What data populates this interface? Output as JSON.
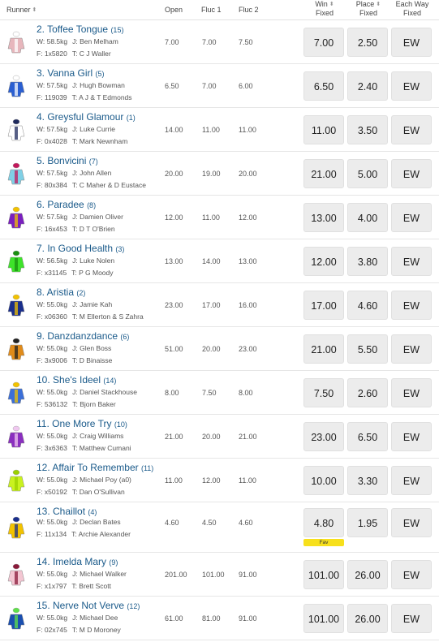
{
  "header": {
    "runner": "Runner",
    "open": "Open",
    "fluc1": "Fluc 1",
    "fluc2": "Fluc 2",
    "win_l1": "Win",
    "win_l2": "Fixed",
    "place_l1": "Place",
    "place_l2": "Fixed",
    "ew_l1": "Each Way",
    "ew_l2": "Fixed",
    "sort_icon": "⬍"
  },
  "runners": [
    {
      "name": "2. Toffee Tongue",
      "barrier": "(15)",
      "weight": "W: 58.5kg",
      "jockey": "J: Ben Melham",
      "form": "F: 1x5820",
      "trainer": "T: C J Waller",
      "open": "7.00",
      "fluc1": "7.00",
      "fluc2": "7.50",
      "win": "7.00",
      "place": "2.50",
      "ew": "EW",
      "fav": "",
      "silk_colors": [
        "#e7b6bc",
        "#ffffff"
      ],
      "silk_icon": "silk-striped-pink-icon"
    },
    {
      "name": "3. Vanna Girl",
      "barrier": "(5)",
      "weight": "W: 57.5kg",
      "jockey": "J: Hugh Bowman",
      "form": "F: 119039",
      "trainer": "T: A J & T Edmonds",
      "open": "6.50",
      "fluc1": "7.00",
      "fluc2": "6.00",
      "win": "6.50",
      "place": "2.40",
      "ew": "EW",
      "fav": "",
      "silk_colors": [
        "#2b5fd1",
        "#ffffff"
      ],
      "silk_icon": "silk-blue-white-icon"
    },
    {
      "name": "4. Greysful Glamour",
      "barrier": "(1)",
      "weight": "W: 57.5kg",
      "jockey": "J: Luke Currie",
      "form": "F: 0x4028",
      "trainer": "T: Mark Newnham",
      "open": "14.00",
      "fluc1": "11.00",
      "fluc2": "11.00",
      "win": "11.00",
      "place": "3.50",
      "ew": "EW",
      "fav": "",
      "silk_colors": [
        "#ffffff",
        "#1f2a5c"
      ],
      "silk_icon": "silk-white-navy-icon"
    },
    {
      "name": "5. Bonvicini",
      "barrier": "(7)",
      "weight": "W: 57.5kg",
      "jockey": "J: John Allen",
      "form": "F: 80x384",
      "trainer": "T: C Maher & D Eustace",
      "open": "20.00",
      "fluc1": "19.00",
      "fluc2": "20.00",
      "win": "21.00",
      "place": "5.00",
      "ew": "EW",
      "fav": "",
      "silk_colors": [
        "#7fd0e6",
        "#c2185b"
      ],
      "silk_icon": "silk-lightblue-cross-icon"
    },
    {
      "name": "6. Paradee",
      "barrier": "(8)",
      "weight": "W: 57.5kg",
      "jockey": "J: Damien Oliver",
      "form": "F: 16x453",
      "trainer": "T: D T O'Brien",
      "open": "12.00",
      "fluc1": "11.00",
      "fluc2": "12.00",
      "win": "13.00",
      "place": "4.00",
      "ew": "EW",
      "fav": "",
      "silk_colors": [
        "#7a1fbf",
        "#f2c200"
      ],
      "silk_icon": "silk-purple-yellow-icon"
    },
    {
      "name": "7. In Good Health",
      "barrier": "(3)",
      "weight": "W: 56.5kg",
      "jockey": "J: Luke Nolen",
      "form": "F: x31145",
      "trainer": "T: P G Moody",
      "open": "13.00",
      "fluc1": "14.00",
      "fluc2": "13.00",
      "win": "12.00",
      "place": "3.80",
      "ew": "EW",
      "fav": "",
      "silk_colors": [
        "#3ee32a",
        "#1a8f10"
      ],
      "silk_icon": "silk-green-icon"
    },
    {
      "name": "8. Aristia",
      "barrier": "(2)",
      "weight": "W: 55.0kg",
      "jockey": "J: Jamie Kah",
      "form": "F: x06360",
      "trainer": "T: M Ellerton & S Zahra",
      "open": "23.00",
      "fluc1": "17.00",
      "fluc2": "16.00",
      "win": "17.00",
      "place": "4.60",
      "ew": "EW",
      "fav": "",
      "silk_colors": [
        "#1a2f8c",
        "#f2c200"
      ],
      "silk_icon": "silk-navy-yellow-icon"
    },
    {
      "name": "9. Danzdanzdance",
      "barrier": "(6)",
      "weight": "W: 55.0kg",
      "jockey": "J: Glen Boss",
      "form": "F: 3x9006",
      "trainer": "T: D Binaisse",
      "open": "51.00",
      "fluc1": "20.00",
      "fluc2": "23.00",
      "win": "21.00",
      "place": "5.50",
      "ew": "EW",
      "fav": "",
      "silk_colors": [
        "#e08b1a",
        "#222222"
      ],
      "silk_icon": "silk-orange-cross-icon"
    },
    {
      "name": "10. She's Ideel",
      "barrier": "(14)",
      "weight": "W: 55.0kg",
      "jockey": "J: Daniel Stackhouse",
      "form": "F: 536132",
      "trainer": "T: Bjorn Baker",
      "open": "8.00",
      "fluc1": "7.50",
      "fluc2": "8.00",
      "win": "7.50",
      "place": "2.60",
      "ew": "EW",
      "fav": "",
      "silk_colors": [
        "#3b6fd8",
        "#f2c200"
      ],
      "silk_icon": "silk-blue-yellow-icon"
    },
    {
      "name": "11. One More Try",
      "barrier": "(10)",
      "weight": "W: 55.0kg",
      "jockey": "J: Craig Williams",
      "form": "F: 3x6363",
      "trainer": "T: Matthew Cumani",
      "open": "21.00",
      "fluc1": "20.00",
      "fluc2": "21.00",
      "win": "23.00",
      "place": "6.50",
      "ew": "EW",
      "fav": "",
      "silk_colors": [
        "#8a2fbf",
        "#f0c8f0"
      ],
      "silk_icon": "silk-purple-stripe-icon"
    },
    {
      "name": "12. Affair To Remember",
      "barrier": "(11)",
      "weight": "W: 55.0kg",
      "jockey": "J: Michael Poy (a0)",
      "form": "F: x50192",
      "trainer": "T: Dan O'Sullivan",
      "open": "11.00",
      "fluc1": "12.00",
      "fluc2": "11.00",
      "win": "10.00",
      "place": "3.30",
      "ew": "EW",
      "fav": "",
      "silk_colors": [
        "#c9f21f",
        "#9bd000"
      ],
      "silk_icon": "silk-lime-icon"
    },
    {
      "name": "13. Chaillot",
      "barrier": "(4)",
      "weight": "W: 55.0kg",
      "jockey": "J: Declan Bates",
      "form": "F: 11x134",
      "trainer": "T: Archie Alexander",
      "open": "4.60",
      "fluc1": "4.50",
      "fluc2": "4.60",
      "win": "4.80",
      "place": "1.95",
      "ew": "EW",
      "fav": "Fav",
      "silk_colors": [
        "#f2c200",
        "#1a2f8c"
      ],
      "silk_icon": "silk-yellow-navy-hoops-icon"
    },
    {
      "name": "14. Imelda Mary",
      "barrier": "(9)",
      "weight": "W: 55.0kg",
      "jockey": "J: Michael Walker",
      "form": "F: x1x797",
      "trainer": "T: Brett Scott",
      "open": "201.00",
      "fluc1": "101.00",
      "fluc2": "91.00",
      "win": "101.00",
      "place": "26.00",
      "ew": "EW",
      "fav": "",
      "silk_colors": [
        "#f3c6d2",
        "#8a1a3a"
      ],
      "silk_icon": "silk-pink-maroon-icon"
    },
    {
      "name": "15. Nerve Not Verve",
      "barrier": "(12)",
      "weight": "W: 55.0kg",
      "jockey": "J: Michael Dee",
      "form": "F: 02x745",
      "trainer": "T: M D Moroney",
      "open": "61.00",
      "fluc1": "81.00",
      "fluc2": "91.00",
      "win": "101.00",
      "place": "26.00",
      "ew": "EW",
      "fav": "",
      "silk_colors": [
        "#1a4fb0",
        "#5fe04a"
      ],
      "silk_icon": "silk-blue-green-sash-icon"
    }
  ]
}
